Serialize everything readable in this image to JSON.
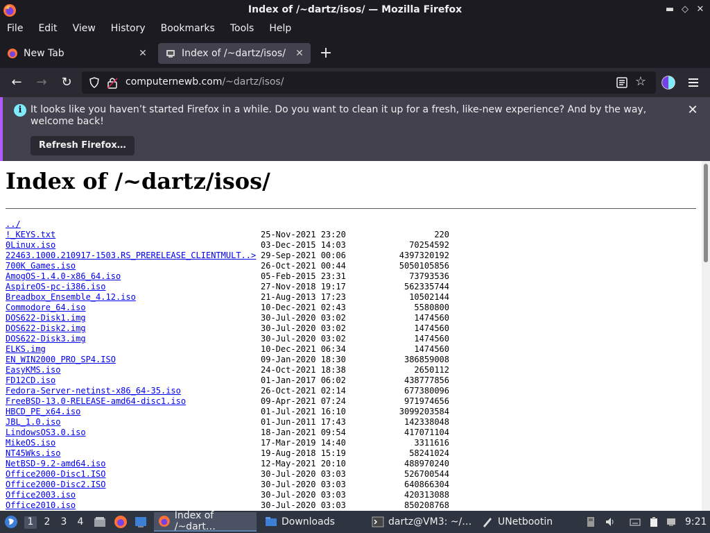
{
  "window": {
    "title": "Index of /~dartz/isos/ — Mozilla Firefox",
    "controls": [
      "minimize",
      "restore",
      "close"
    ]
  },
  "menubar": {
    "items": [
      "File",
      "Edit",
      "View",
      "History",
      "Bookmarks",
      "Tools",
      "Help"
    ]
  },
  "tabs": [
    {
      "label": "New Tab",
      "active": false
    },
    {
      "label": "Index of /~dartz/isos/",
      "active": true
    }
  ],
  "urlbar": {
    "host": "computernewb.com",
    "path": "/~dartz/isos/"
  },
  "notification": {
    "message": "It looks like you haven’t started Firefox in a while. Do you want to clean it up for a fresh, like-new experience? And by the way, welcome back!",
    "button_label": "Refresh Firefox…"
  },
  "page": {
    "heading": "Index of /~dartz/isos/",
    "parent_link": "../",
    "entries": [
      {
        "name": "!_KEYS.txt",
        "date": "25-Nov-2021 23:20",
        "size": "220"
      },
      {
        "name": "0Linux.iso",
        "date": "03-Dec-2015 14:03",
        "size": "70254592"
      },
      {
        "name": "22463.1000.210917-1503.RS_PRERELEASE_CLIENTMULT..>",
        "date": "29-Sep-2021 00:06",
        "size": "4397320192"
      },
      {
        "name": "700K_Games.iso",
        "date": "26-Oct-2021 00:44",
        "size": "5050105856"
      },
      {
        "name": "AmogOS-1.4.0-x86_64.iso",
        "date": "05-Feb-2015 23:31",
        "size": "73793536"
      },
      {
        "name": "AspireOS-pc-i386.iso",
        "date": "27-Nov-2018 19:17",
        "size": "562335744"
      },
      {
        "name": "Breadbox_Ensemble_4.12.iso",
        "date": "21-Aug-2013 17:23",
        "size": "10502144"
      },
      {
        "name": "Commodore_64.iso",
        "date": "10-Dec-2021 02:43",
        "size": "5580800"
      },
      {
        "name": "DOS622-Disk1.img",
        "date": "30-Jul-2020 03:02",
        "size": "1474560"
      },
      {
        "name": "DOS622-Disk2.img",
        "date": "30-Jul-2020 03:02",
        "size": "1474560"
      },
      {
        "name": "DOS622-Disk3.img",
        "date": "30-Jul-2020 03:02",
        "size": "1474560"
      },
      {
        "name": "ELKS.img",
        "date": "10-Dec-2021 06:34",
        "size": "1474560"
      },
      {
        "name": "EN_WIN2000_PRO_SP4.ISO",
        "date": "09-Jan-2020 18:30",
        "size": "386859008"
      },
      {
        "name": "EasyKMS.iso",
        "date": "24-Oct-2021 18:38",
        "size": "2650112"
      },
      {
        "name": "FD12CD.iso",
        "date": "01-Jan-2017 06:02",
        "size": "438777856"
      },
      {
        "name": "Fedora-Server-netinst-x86_64-35.iso",
        "date": "26-Oct-2021 02:14",
        "size": "677380096"
      },
      {
        "name": "FreeBSD-13.0-RELEASE-amd64-disc1.iso",
        "date": "09-Apr-2021 07:24",
        "size": "971974656"
      },
      {
        "name": "HBCD_PE_x64.iso",
        "date": "01-Jul-2021 16:10",
        "size": "3099203584"
      },
      {
        "name": "JBL_1.0.iso",
        "date": "01-Jun-2011 17:43",
        "size": "142338048"
      },
      {
        "name": "LindowsOS3.0.iso",
        "date": "18-Jan-2021 09:54",
        "size": "417071104"
      },
      {
        "name": "MikeOS.iso",
        "date": "17-Mar-2019 14:40",
        "size": "3311616"
      },
      {
        "name": "NT45Wks.iso",
        "date": "19-Aug-2018 15:19",
        "size": "58241024"
      },
      {
        "name": "NetBSD-9.2-amd64.iso",
        "date": "12-May-2021 20:10",
        "size": "488970240"
      },
      {
        "name": "Office2000-Disc1.ISO",
        "date": "30-Jul-2020 03:03",
        "size": "526700544"
      },
      {
        "name": "Office2000-Disc2.ISO",
        "date": "30-Jul-2020 03:03",
        "size": "640866304"
      },
      {
        "name": "Office2003.iso",
        "date": "30-Jul-2020 03:03",
        "size": "420313088"
      },
      {
        "name": "Office2010.iso",
        "date": "30-Jul-2020 03:03",
        "size": "850208768"
      }
    ]
  },
  "taskbar": {
    "workspaces": [
      "1",
      "2",
      "3",
      "4"
    ],
    "active_workspace": "1",
    "tasks": [
      {
        "label": "Index of /~dart…",
        "icon": "firefox-icon",
        "active": true
      },
      {
        "label": "Downloads",
        "icon": "folder-icon",
        "active": false
      },
      {
        "label": "dartz@VM3: ~/…",
        "icon": "terminal-icon",
        "active": false
      },
      {
        "label": "UNetbootin",
        "icon": "unetbootin-icon",
        "active": false
      }
    ],
    "clock": "9:21"
  },
  "colors": {
    "chrome_bg": "#1c1b22",
    "toolbar_bg": "#2b2a33",
    "notice_bg": "#42414d",
    "link": "#0000ee",
    "taskbar_bg": "#2e3440"
  }
}
